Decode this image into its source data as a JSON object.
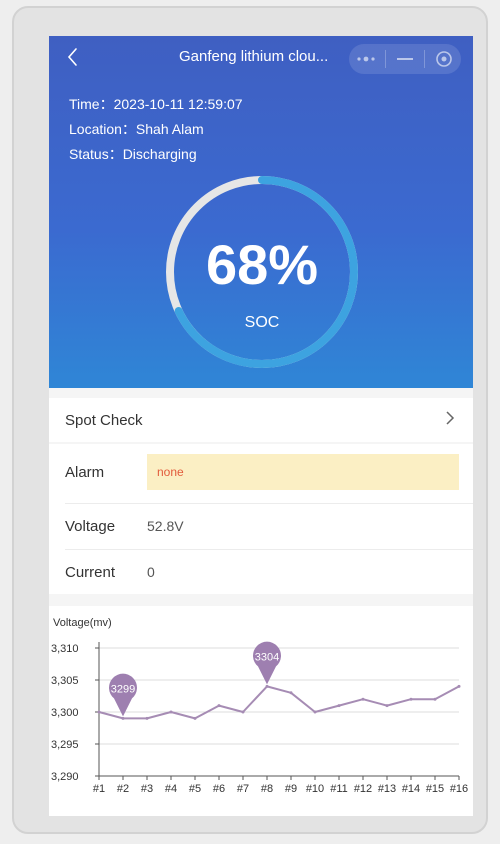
{
  "header": {
    "title": "Ganfeng lithium clou...",
    "back_icon": "back-chevron-icon",
    "menu_icon": "more-dots-icon",
    "minimize_icon": "minimize-icon",
    "close_icon": "target-close-icon"
  },
  "info": {
    "time": "Time：2023-10-11 12:59:07",
    "location": "Location：Shah Alam",
    "status": "Status：Discharging"
  },
  "soc": {
    "value_text": "68%",
    "value": 0.68,
    "label": "SOC"
  },
  "spot_check": {
    "label": "Spot Check"
  },
  "alarm": {
    "label": "Alarm",
    "value": "none"
  },
  "voltage": {
    "label": "Voltage",
    "value": "52.8V"
  },
  "current": {
    "label": "Current",
    "value": "0"
  },
  "colors": {
    "hero_top": "#3f5fc2",
    "hero_bottom": "#2f86d6",
    "gauge_fill": "#3da3e0",
    "gauge_track": "#e6e6e6",
    "alarm_bg": "#fbefc4",
    "alarm_text": "#e25b3b",
    "series": "#a68cb4"
  },
  "chart_data": {
    "type": "line",
    "ylabel": "Voltage(mv)",
    "ylim": [
      3290,
      3310
    ],
    "yticks": [
      3290,
      3295,
      3300,
      3305,
      3310
    ],
    "ytick_labels": [
      "3,290",
      "3,295",
      "3,300",
      "3,305",
      "3,310"
    ],
    "categories": [
      "#1",
      "#2",
      "#3",
      "#4",
      "#5",
      "#6",
      "#7",
      "#8",
      "#9",
      "#10",
      "#11",
      "#12",
      "#13",
      "#14",
      "#15",
      "#16"
    ],
    "values": [
      3300,
      3299,
      3299,
      3300,
      3299,
      3301,
      3300,
      3304,
      3303,
      3300,
      3301,
      3302,
      3301,
      3302,
      3302,
      3304
    ],
    "markers": [
      {
        "index": 1,
        "label": "3299"
      },
      {
        "index": 7,
        "label": "3304"
      }
    ],
    "grid": true
  }
}
